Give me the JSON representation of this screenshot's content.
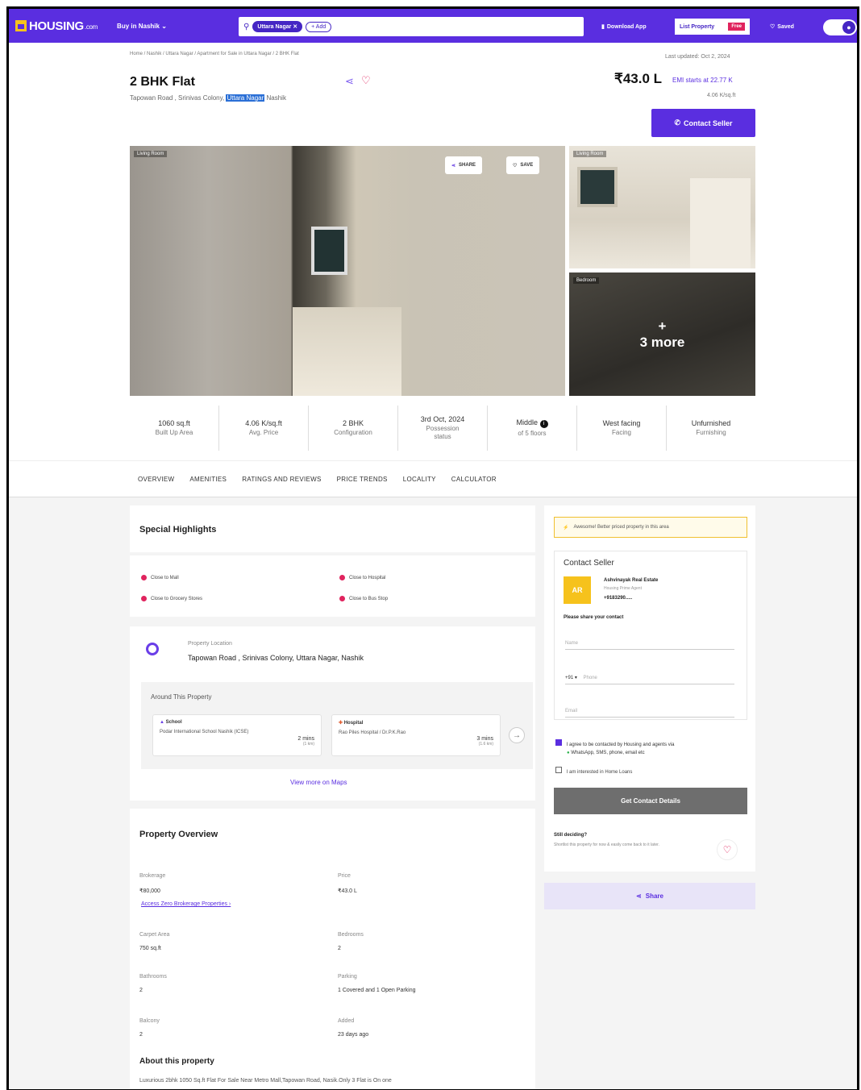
{
  "nav": {
    "logo": "HOUSING",
    "logo_suffix": ".com",
    "buy_in": "Buy in Nashik",
    "search_chip": "Uttara Nagar",
    "add_chip": "+ Add",
    "download_app": "Download App",
    "list_property": "List Property",
    "free_badge": "Free",
    "saved": "Saved",
    "accent": "#5a2ee0"
  },
  "header": {
    "breadcrumb": "Home / Nashik / Uttara Nagar / Apartment for Sale in Uttara Nagar / 2 BHK Flat",
    "last_updated": "Last updated: Oct 2, 2024",
    "title": "2 BHK Flat",
    "address_prefix": "Tapowan Road , Srinivas Colony, ",
    "address_highlight": "Uttara Nagar",
    "address_suffix": " Nashik",
    "price": "₹43.0 L",
    "emi": "EMI starts at  22.77 K",
    "price_per_sqft": "4.06 K/sq.ft",
    "contact_button": "Contact Seller"
  },
  "gallery": {
    "main_tag": "Living Room",
    "share_label": "SHARE",
    "save_label": "SAVE",
    "top_right_tag": "Living Room",
    "bottom_right_tag": "Bedroom",
    "more_plus": "+",
    "more_label": "3 more"
  },
  "stats": [
    {
      "value": "1060 sq.ft",
      "label": "Built Up Area"
    },
    {
      "value": "4.06 K/sq.ft",
      "label": "Avg. Price"
    },
    {
      "value": "2 BHK",
      "label": "Configuration"
    },
    {
      "value": "3rd Oct, 2024",
      "label": "Possession status"
    },
    {
      "value": "Middle",
      "label": "of 5 floors"
    },
    {
      "value": "West facing",
      "label": "Facing"
    },
    {
      "value": "Unfurnished",
      "label": "Furnishing"
    }
  ],
  "tabs": [
    "OVERVIEW",
    "AMENITIES",
    "RATINGS AND REVIEWS",
    "PRICE TRENDS",
    "LOCALITY",
    "CALCULATOR"
  ],
  "highlights": {
    "title": "Special Highlights",
    "items": [
      "Close to Mall",
      "Close to Hospital",
      "Close to Grocery Stores",
      "Close to Bus Stop"
    ]
  },
  "location": {
    "label": "Property Location",
    "value": "Tapowan Road , Srinivas Colony, Uttara Nagar, Nashik",
    "around_title": "Around This Property",
    "places": [
      {
        "type": "School",
        "name": "Podar International School Nashik (ICSE)",
        "time": "2 mins",
        "dist": "(1 km)"
      },
      {
        "type": "Hospital",
        "name": "Rao Piles Hospital / Dr.P.K.Rao",
        "time": "3 mins",
        "dist": "(1.6 km)"
      }
    ],
    "view_more": "View more on Maps"
  },
  "overview": {
    "title": "Property Overview",
    "brokerage_label": "Brokerage",
    "brokerage_value": "₹80,000",
    "zero_brokerage_link": "Access Zero Brokerage Properties ›",
    "price_label": "Price",
    "price_value": "₹43.0 L",
    "carpet_label": "Carpet Area",
    "carpet_value": "750 sq.ft",
    "bedrooms_label": "Bedrooms",
    "bedrooms_value": "2",
    "bathrooms_label": "Bathrooms",
    "bathrooms_value": "2",
    "parking_label": "Parking",
    "parking_value": "1 Covered and 1 Open Parking",
    "balcony_label": "Balcony",
    "balcony_value": "2",
    "added_label": "Added",
    "added_value": "23 days ago",
    "about_title": "About this property",
    "about_text": "Luxurious 2bhk 1050 Sq.ft Flat For Sale Near Metro Mall,Tapowan Road, Nasik.Only 3 Flat is On one"
  },
  "sidebar": {
    "warning": "Awesome! Better priced property in this area",
    "contact_title": "Contact Seller",
    "agent_initials": "AR",
    "agent_name": "Ashvinayak Real Estate",
    "agent_role": "Housing Prime Agent",
    "agent_phone": "+9183290.....",
    "share_contact": "Please share your contact",
    "name_placeholder": "Name",
    "country_code": "+91",
    "phone_placeholder": "Phone",
    "email_placeholder": "Email",
    "agree_text": "I agree to be contacted by Housing and agents via",
    "agree_channels": "WhatsApp, SMS, phone, email etc",
    "home_loans": "I am interested in Home Loans",
    "get_contact": "Get Contact Details",
    "still_deciding": "Still deciding?",
    "still_text": "Shortlist this property for now & easily come back to it later.",
    "share_label": "Share"
  }
}
